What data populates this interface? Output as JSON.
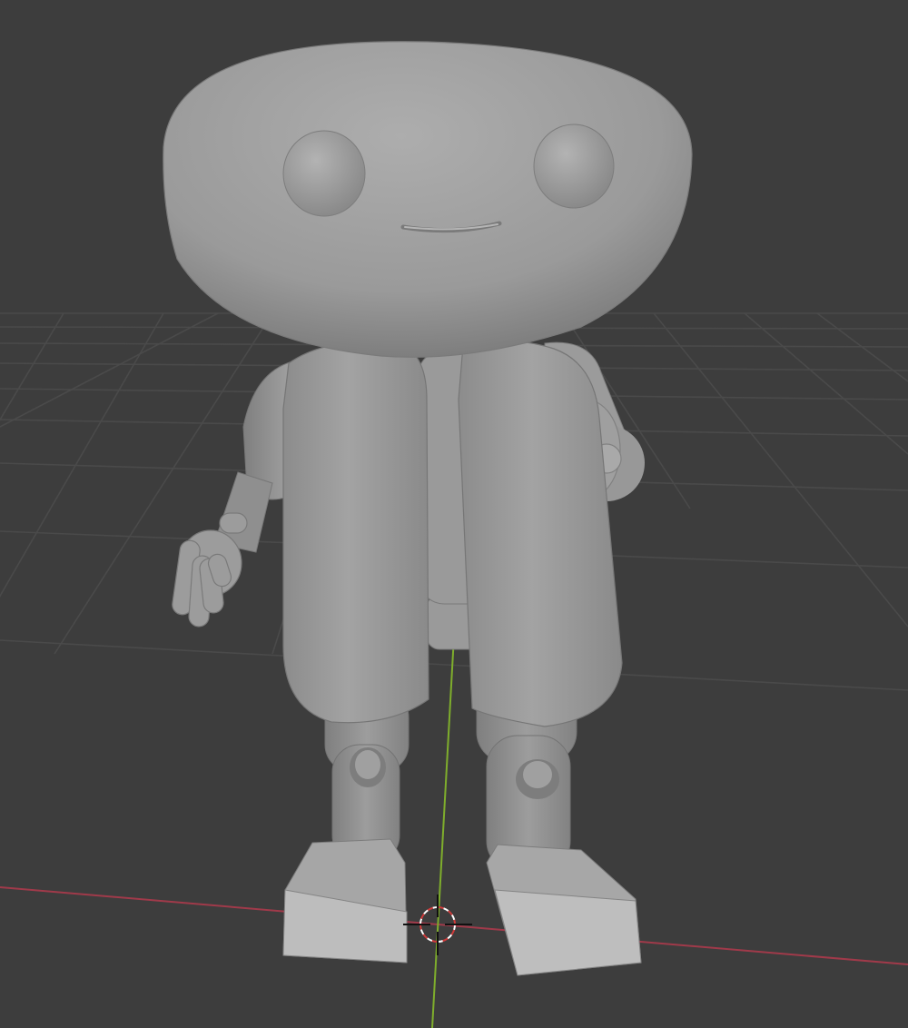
{
  "app": {
    "name": "",
    "view": ""
  },
  "viewport": {
    "background_color": "#3d3d3d",
    "grid_color": "#4a4a4a",
    "grid_major_color": "#555555"
  },
  "axes": {
    "x_axis_color": "#a03a4a",
    "y_axis_color": "#7fae2c"
  },
  "model": {
    "name": "",
    "shading": "solid",
    "base_color": "#9a9a9a"
  },
  "cursor_3d": {
    "ring_colors": [
      "#d03b3b",
      "#ffffff"
    ],
    "crosshair_color": "#111111"
  }
}
